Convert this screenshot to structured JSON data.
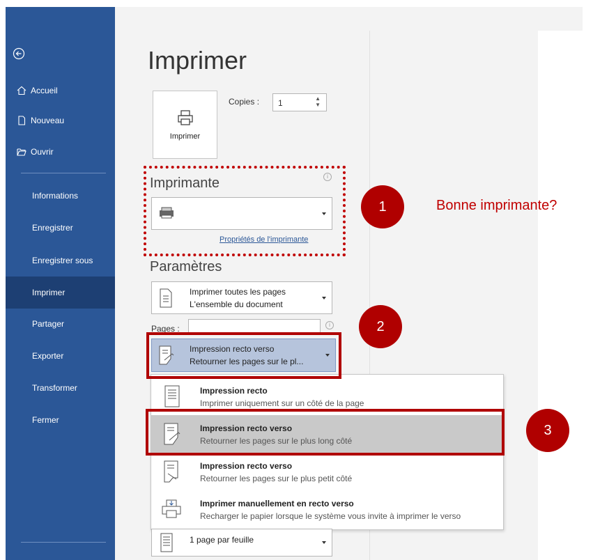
{
  "sidebar": {
    "back_label": "",
    "top_items": [
      {
        "label": "Accueil",
        "icon": "home-icon"
      },
      {
        "label": "Nouveau",
        "icon": "new-document-icon"
      },
      {
        "label": "Ouvrir",
        "icon": "folder-open-icon"
      }
    ],
    "items": [
      {
        "label": "Informations"
      },
      {
        "label": "Enregistrer"
      },
      {
        "label": "Enregistrer sous"
      },
      {
        "label": "Imprimer",
        "active": true
      },
      {
        "label": "Partager"
      },
      {
        "label": "Exporter"
      },
      {
        "label": "Transformer"
      },
      {
        "label": "Fermer"
      }
    ],
    "colors": {
      "background": "#2b5797",
      "active": "#1d3f73"
    }
  },
  "main": {
    "title": "Imprimer",
    "print_button_label": "Imprimer",
    "copies_label": "Copies :",
    "copies_value": "1",
    "printer_section_title": "Imprimante",
    "printer_name": "",
    "printer_properties_link": "Propriétés de l'imprimante",
    "settings_title": "Paramètres",
    "pages_setting": {
      "line1": "Imprimer toutes les pages",
      "line2": "L'ensemble du document"
    },
    "pages_label": "Pages :",
    "pages_value": "",
    "duplex_setting": {
      "line1": "Impression recto verso",
      "line2": "Retourner les pages sur le pl..."
    },
    "per_sheet_setting": {
      "line1": "1 page par feuille"
    }
  },
  "duplex_menu": {
    "options": [
      {
        "title": "Impression recto",
        "desc": "Imprimer uniquement sur un côté de la page",
        "icon": "single-sided-icon"
      },
      {
        "title": "Impression recto verso",
        "desc": "Retourner les pages sur le plus long côté",
        "icon": "duplex-long-edge-icon",
        "highlighted": true
      },
      {
        "title": "Impression recto verso",
        "desc": "Retourner les pages sur le plus petit côté",
        "icon": "duplex-short-edge-icon"
      },
      {
        "title": "Imprimer manuellement en recto verso",
        "desc": "Recharger le papier lorsque le système vous invite à imprimer le verso",
        "icon": "manual-duplex-icon"
      }
    ]
  },
  "annotations": {
    "step1": "1",
    "step1_text": "Bonne imprimante?",
    "step2": "2",
    "step3": "3",
    "color": "#c00000"
  }
}
